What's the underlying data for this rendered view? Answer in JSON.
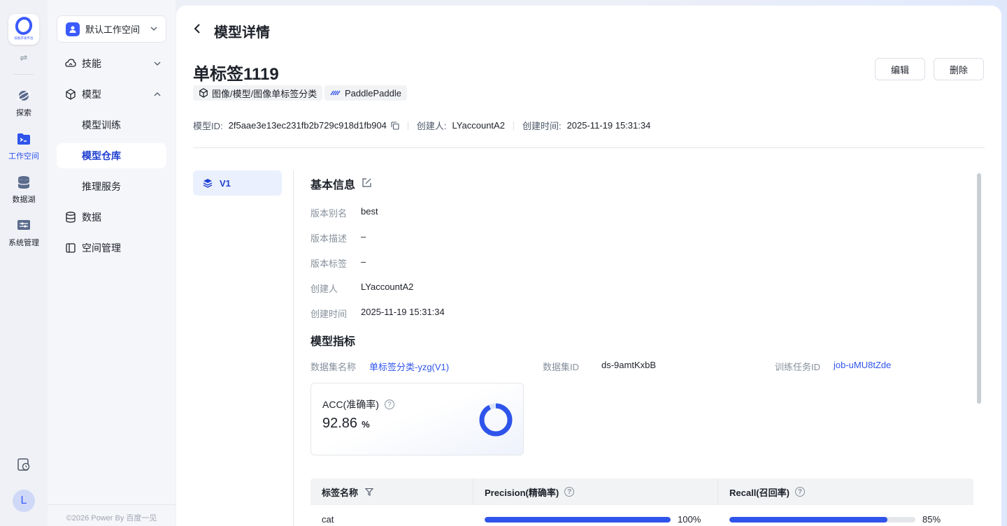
{
  "rail": {
    "logo_text": "技能开发平台",
    "items": [
      {
        "label": "探索"
      },
      {
        "label": "工作空间"
      },
      {
        "label": "数据湖"
      },
      {
        "label": "系统管理"
      }
    ],
    "avatar": "L"
  },
  "sidebar": {
    "workspace": "默认工作空间",
    "items": [
      {
        "label": "技能"
      },
      {
        "label": "模型"
      },
      {
        "label": "模型训练"
      },
      {
        "label": "模型仓库"
      },
      {
        "label": "推理服务"
      },
      {
        "label": "数据"
      },
      {
        "label": "空间管理"
      }
    ],
    "copyright": "©2026 Power By 百度一见"
  },
  "header": {
    "title": "模型详情",
    "model_name": "单标签1119",
    "edit_label": "编辑",
    "delete_label": "删除",
    "tags": [
      "图像/模型/图像单标签分类",
      "PaddlePaddle"
    ],
    "meta": {
      "id_key": "模型ID:",
      "id_value": "2f5aae3e13ec231fb2b729c918d1fb904",
      "creator_key": "创建人:",
      "creator_value": "LYaccountA2",
      "time_key": "创建时间:",
      "time_value": "2025-11-19 15:31:34"
    }
  },
  "version_tab": "V1",
  "basic": {
    "title": "基本信息",
    "rows": [
      {
        "k": "版本别名",
        "v": "best"
      },
      {
        "k": "版本描述",
        "v": "–"
      },
      {
        "k": "版本标签",
        "v": "–"
      },
      {
        "k": "创建人",
        "v": "LYaccountA2"
      },
      {
        "k": "创建时间",
        "v": "2025-11-19 15:31:34"
      }
    ]
  },
  "metrics": {
    "title": "模型指标",
    "dataset_name_key": "数据集名称",
    "dataset_name_value": "单标签分类-yzg(V1)",
    "dataset_id_key": "数据集ID",
    "dataset_id_value": "ds-9amtKxbB",
    "job_id_key": "训练任务ID",
    "job_id_value": "job-uMU8tZde",
    "acc_label": "ACC(准确率)",
    "acc_value": "92.86",
    "acc_unit": "%",
    "acc_fraction": 0.9286,
    "accent_color": "#2f54eb"
  },
  "table": {
    "headers": [
      "标签名称",
      "Precision(精确率)",
      "Recall(召回率)"
    ],
    "rows": [
      {
        "label": "cat",
        "precision": "100%",
        "precision_fraction": 1.0,
        "recall": "85%",
        "recall_fraction": 0.85
      }
    ]
  }
}
